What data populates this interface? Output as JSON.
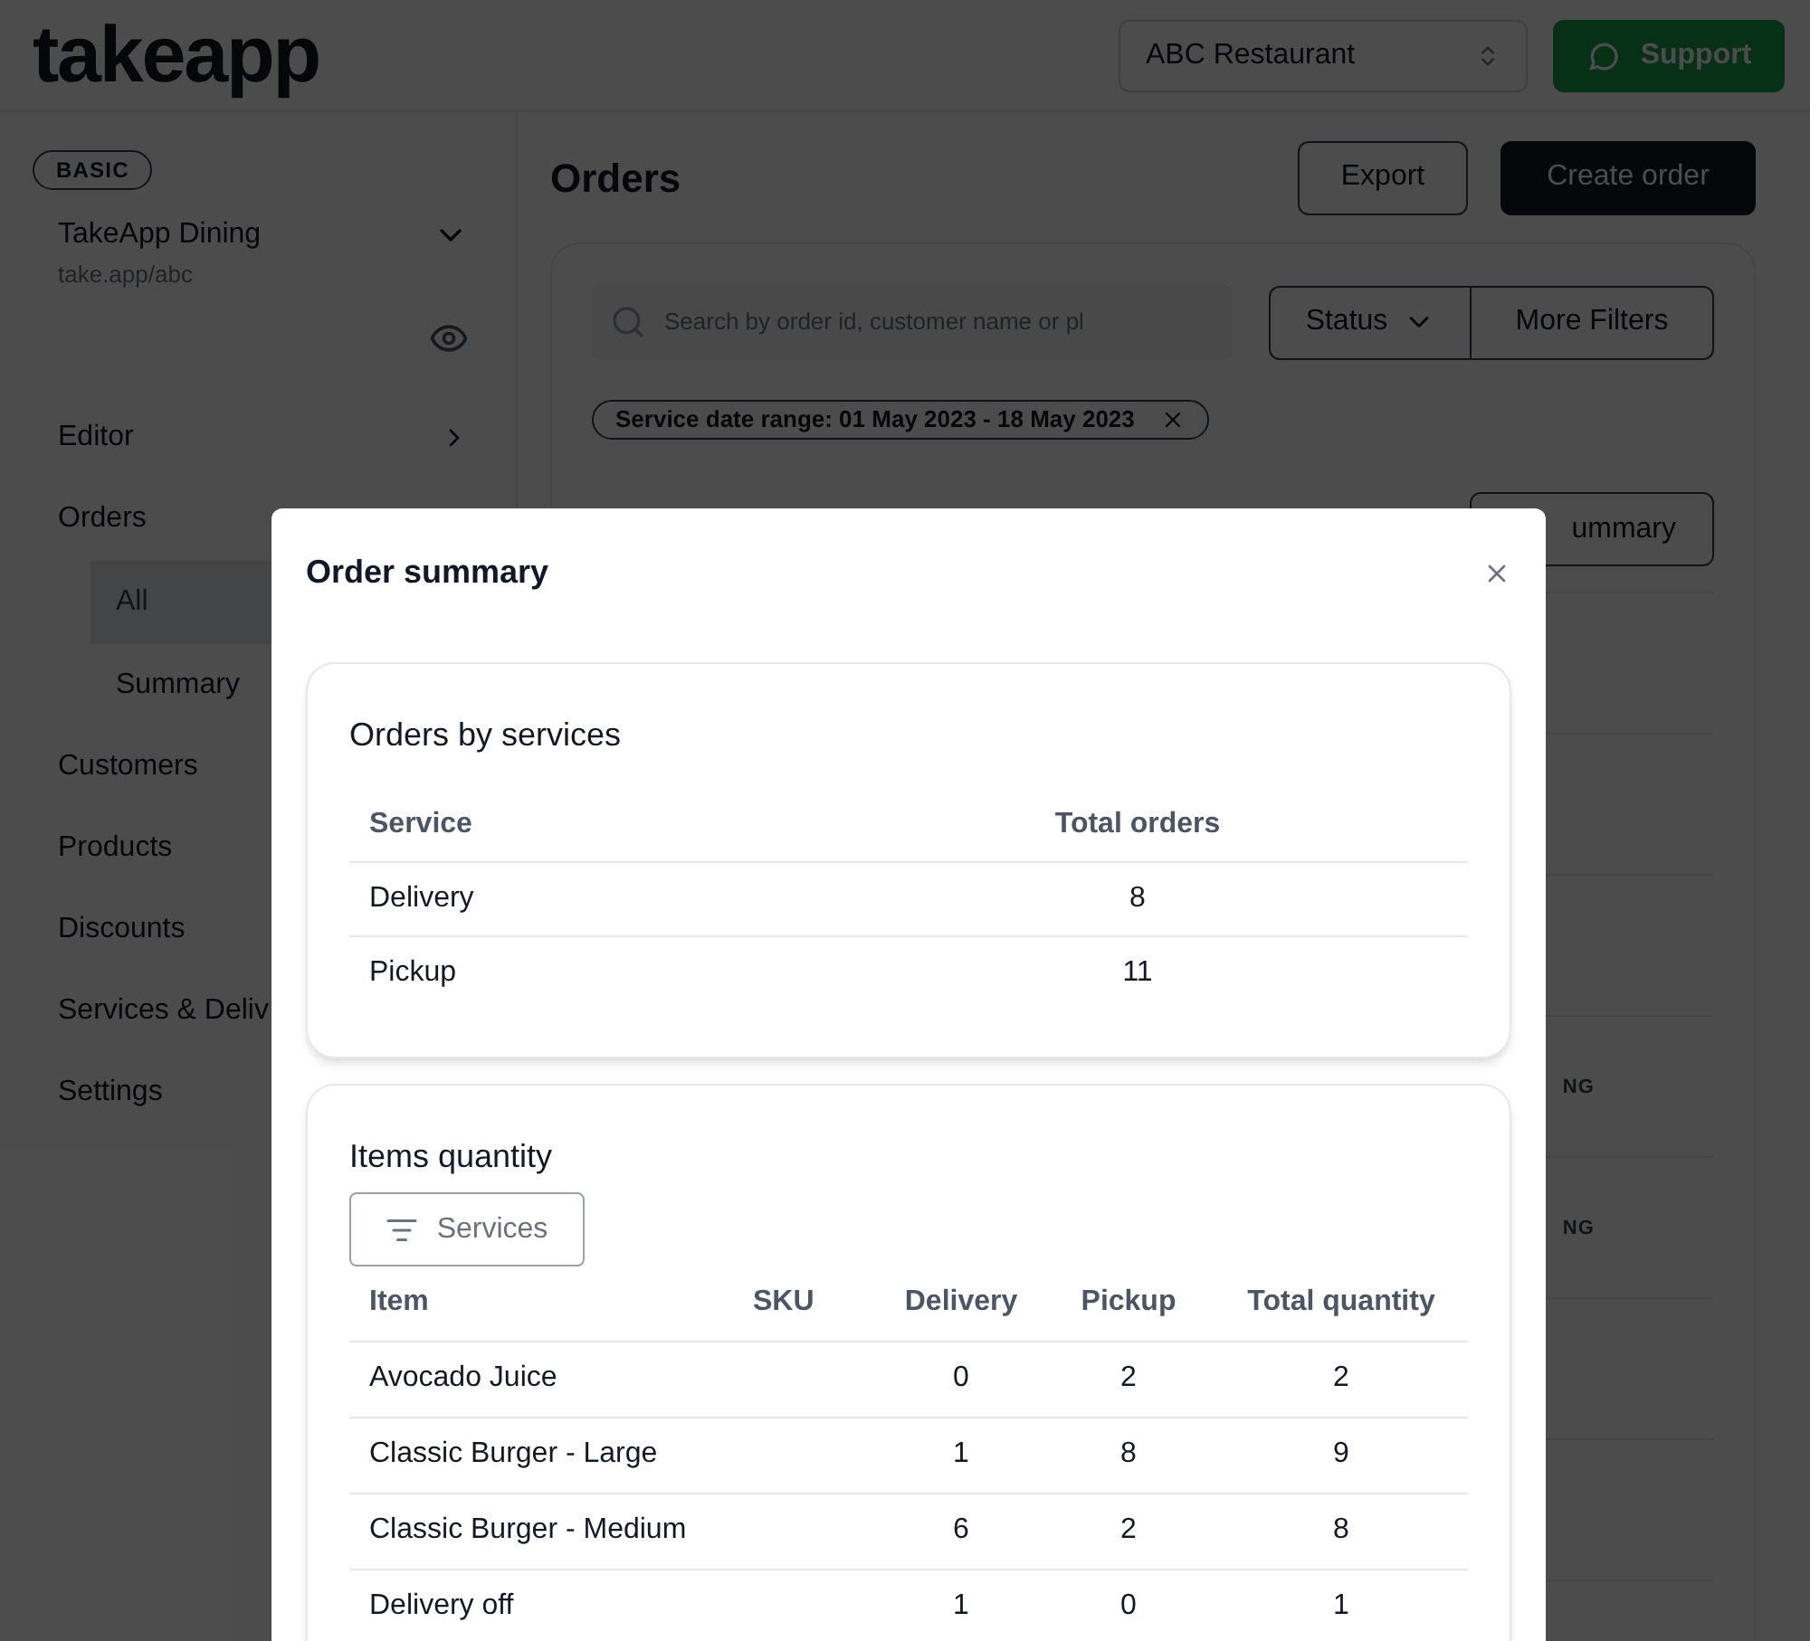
{
  "header": {
    "logo": "takeapp",
    "store_select": "ABC Restaurant",
    "support_button": "Support"
  },
  "sidebar": {
    "plan_badge": "BASIC",
    "store_name": "TakeApp Dining",
    "store_url": "take.app/abc",
    "items": [
      {
        "label": "Editor",
        "chevron": true
      },
      {
        "label": "Orders",
        "children": [
          {
            "label": "All",
            "selected": true
          },
          {
            "label": "Summary",
            "selected": false
          }
        ]
      },
      {
        "label": "Customers"
      },
      {
        "label": "Products"
      },
      {
        "label": "Discounts"
      },
      {
        "label": "Services & Deliv"
      },
      {
        "label": "Settings"
      }
    ]
  },
  "page": {
    "title": "Orders",
    "export_button": "Export",
    "create_button": "Create order",
    "search": {
      "placeholder": "Search by order id, customer name or pl"
    },
    "status_filter": "Status",
    "more_filters": "More Filters",
    "filter_chip": "Service date range: 01 May 2023 - 18 May 2023",
    "summary_button": "ummary",
    "order_rows": [
      {
        "status": ""
      },
      {
        "status": ""
      },
      {
        "status": ""
      },
      {
        "status": "NG"
      },
      {
        "status": "NG"
      },
      {
        "status": ""
      },
      {
        "status": ""
      }
    ]
  },
  "modal": {
    "title": "Order summary",
    "services_card": {
      "title": "Orders by services",
      "columns": [
        "Service",
        "Total orders"
      ],
      "rows": [
        [
          "Delivery",
          "8"
        ],
        [
          "Pickup",
          "11"
        ]
      ]
    },
    "items_card": {
      "title": "Items quantity",
      "filter_button": "Services",
      "columns": [
        "Item",
        "SKU",
        "Delivery",
        "Pickup",
        "Total quantity"
      ],
      "rows": [
        [
          "Avocado Juice",
          "",
          "0",
          "2",
          "2"
        ],
        [
          "Classic Burger - Large",
          "",
          "1",
          "8",
          "9"
        ],
        [
          "Classic Burger - Medium",
          "",
          "6",
          "2",
          "8"
        ],
        [
          "Delivery off",
          "",
          "1",
          "0",
          "1"
        ]
      ]
    }
  }
}
